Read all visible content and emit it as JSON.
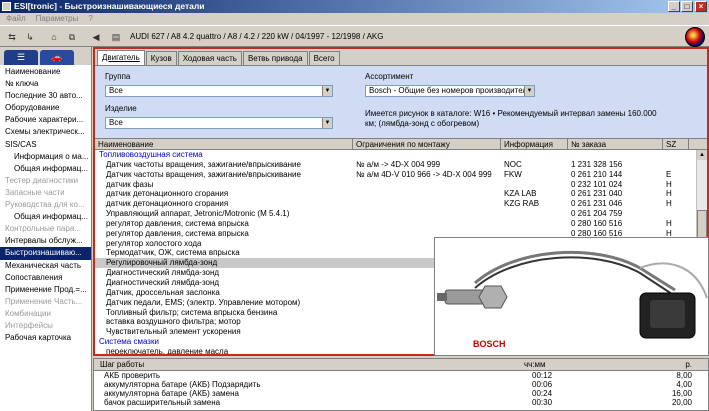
{
  "window": {
    "title": "ESI[tronic] - Быстроизнашивающиеся детали"
  },
  "menu": [
    "Файл",
    "Параметры",
    "?"
  ],
  "toolbar": {
    "car_info": "AUDI 627 / A8 4.2 quattro / A8 / 4.2 / 220 kW / 04/1997 - 12/1998 / AKG"
  },
  "sidebar": {
    "items": [
      {
        "label": "Наименование",
        "state": "normal"
      },
      {
        "label": "№ ключа",
        "state": "normal"
      },
      {
        "label": "Последние 30 авто...",
        "state": "normal"
      },
      {
        "label": "Оборудование",
        "state": "normal"
      },
      {
        "label": "Рабочие характери...",
        "state": "normal"
      },
      {
        "label": "Схемы электрическ...",
        "state": "normal"
      },
      {
        "label": "SIS/CAS",
        "state": "normal"
      },
      {
        "label": "Информация о ма...",
        "state": "indent"
      },
      {
        "label": "Общая информац...",
        "state": "indent"
      },
      {
        "label": "Тестер диагностики",
        "state": "disabled"
      },
      {
        "label": "Запасные части",
        "state": "disabled"
      },
      {
        "label": "Руководства для ко...",
        "state": "disabled"
      },
      {
        "label": "Общая информац...",
        "state": "indent"
      },
      {
        "label": "Контрольные пара...",
        "state": "disabled"
      },
      {
        "label": "Интервалы обслуж...",
        "state": "normal"
      },
      {
        "label": "Быстроизнашиваю...",
        "state": "selected"
      },
      {
        "label": "Механическая часть",
        "state": "normal"
      },
      {
        "label": "Сопоставления",
        "state": "normal"
      },
      {
        "label": "Применение Прод.=...",
        "state": "normal"
      },
      {
        "label": "Применение Часть...",
        "state": "disabled"
      },
      {
        "label": "Комбинации",
        "state": "disabled"
      },
      {
        "label": "Интерфейсы",
        "state": "disabled"
      },
      {
        "label": "Рабочая карточка",
        "state": "normal"
      }
    ]
  },
  "tabs": [
    {
      "label": "Двигатель",
      "active": true
    },
    {
      "label": "Кузов",
      "active": false
    },
    {
      "label": "Ходовая часть",
      "active": false
    },
    {
      "label": "Ветвь привода",
      "active": false
    },
    {
      "label": "Всего",
      "active": false
    }
  ],
  "filters": {
    "group_label": "Группа",
    "group_value": "Все",
    "product_label": "Изделие",
    "product_value": "Все",
    "assortment_label": "Ассортимент",
    "assortment_value": "Bosch - Общие без номеров производител",
    "info_text": "Имеется рисунок в каталоге: W16 • Рекомендуемый интервал замены 160.000 км; (лямбда-зонд с обогревом)"
  },
  "grid": {
    "headers": [
      "Наименование",
      "Ограничения по монтажу",
      "Информация",
      "№ заказа",
      "SZ"
    ],
    "rows": [
      {
        "type": "group",
        "name": "Топливовоздушная система"
      },
      {
        "name": "Датчик частоты вращения, зажигание/впрыскивание",
        "restr": "№ а/м -> 4D-X 004 999",
        "info": "NOC",
        "order": "1 231 328 156",
        "sz": ""
      },
      {
        "name": "Датчик частоты вращения, зажигание/впрыскивание",
        "restr": "№ а/м 4D-V 010 966 -> 4D-X 004 999",
        "info": "FKW",
        "order": "0 261 210 144",
        "sz": "E"
      },
      {
        "name": "датчик фазы",
        "restr": "",
        "info": "",
        "order": "0 232 101 024",
        "sz": "H"
      },
      {
        "name": "датчик детонационного сгорания",
        "restr": "",
        "info": "KZA LAB",
        "order": "0 261 231 040",
        "sz": "H"
      },
      {
        "name": "датчик детонационного сгорания",
        "restr": "",
        "info": "KZG RAB",
        "order": "0 261 231 046",
        "sz": "H"
      },
      {
        "name": "Управляющий аппарат, Jetronic/Motronic (M 5.4.1)",
        "restr": "",
        "info": "",
        "order": "0 261 204 759",
        "sz": ""
      },
      {
        "name": "регулятор давления, система впрыска",
        "restr": "",
        "info": "",
        "order": "0 280 160 516",
        "sz": "H"
      },
      {
        "name": "регулятор давления, система впрыска",
        "restr": "",
        "info": "",
        "order": "0 280 160 516",
        "sz": "H"
      },
      {
        "name": "регулятор холостого хода",
        "restr": "",
        "info": "",
        "order": "",
        "sz": ""
      },
      {
        "name": "Термодатчик, ОЖ, система впрыска",
        "restr": "",
        "info": "KZS",
        "order": "",
        "sz": ""
      },
      {
        "name": "Регулировочный лямбда-зонд",
        "restr": "",
        "info": "W16",
        "order": "",
        "sz": "",
        "hl": true
      },
      {
        "name": "Диагностический лямбда-зонд",
        "restr": "",
        "info": "LAB W",
        "order": "",
        "sz": ""
      },
      {
        "name": "Диагностический лямбда-зонд",
        "restr": "",
        "info": "RAB W",
        "order": "",
        "sz": ""
      },
      {
        "name": "Датчик, дроссельная заслонка",
        "restr": "",
        "info": "",
        "order": "",
        "sz": ""
      },
      {
        "name": "Датчик педали, EMS; (электр. Управление мотором)",
        "restr": "",
        "info": "",
        "order": "",
        "sz": ""
      },
      {
        "name": "Топливный фильтр; система впрыска бензина",
        "restr": "",
        "info": "",
        "order": "",
        "sz": ""
      },
      {
        "name": "вставка воздушного фильтра; мотор",
        "restr": "",
        "info": "EFV",
        "order": "",
        "sz": ""
      },
      {
        "name": "Чувствительный элемент ускорения",
        "restr": "",
        "info": "",
        "order": "",
        "sz": ""
      },
      {
        "type": "group",
        "name": "Система смазки"
      },
      {
        "name": "переключатель, давление масла",
        "restr": "",
        "info": "KZB",
        "order": "",
        "sz": ""
      }
    ]
  },
  "image": {
    "brand": "BOSCH"
  },
  "bottom": {
    "headers": [
      "Шаг работы",
      "чч:мм",
      "р."
    ],
    "rows": [
      {
        "step": "АКБ проверить",
        "time": "00:12",
        "price": "8,00"
      },
      {
        "step": "аккумуляторна батаре (АКБ) Подзарядить",
        "time": "00:06",
        "price": "4,00"
      },
      {
        "step": "аккумуляторна батаре (АКБ) замена",
        "time": "00:24",
        "price": "16,00"
      },
      {
        "step": "бачок расширительный замена",
        "time": "00:30",
        "price": "20,00"
      }
    ]
  }
}
